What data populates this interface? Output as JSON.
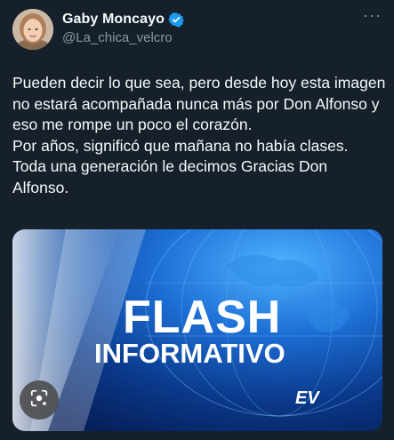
{
  "author": {
    "display_name": "Gaby Moncayo",
    "handle": "@La_chica_velcro",
    "verified_icon": "verified-badge-icon"
  },
  "menu": {
    "icon": "more-horizontal-icon",
    "glyph": "···"
  },
  "tweet": {
    "text": "Pueden decir lo que sea, pero desde hoy esta imagen no estará acompañada nunca más por Don Alfonso y eso me rompe un poco el corazón.\nPor años, significó que mañana no había clases.\nToda una generación le decimos Gracias Don Alfonso."
  },
  "media": {
    "headline": "FLASH",
    "subheadline": "INFORMATIVO",
    "logo": "EV",
    "lens_icon": "visual-search-icon"
  },
  "colors": {
    "background": "#15202b",
    "text": "#f7f9f9",
    "muted": "#8b98a5",
    "verified": "#1d9bf0",
    "media_blue": "#0a3a8c"
  }
}
